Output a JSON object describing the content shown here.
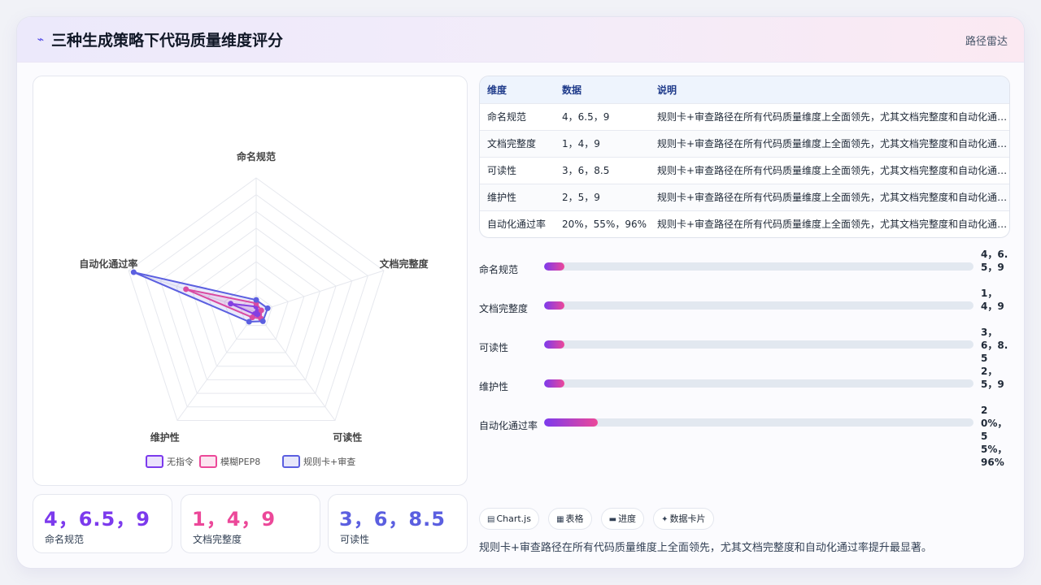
{
  "header": {
    "icon": "pulse-icon",
    "title": "三种生成策略下代码质量维度评分",
    "tag": "路径雷达"
  },
  "chart_data": {
    "type": "radar",
    "title": "",
    "axes": [
      "命名规范",
      "文档完整度",
      "可读性",
      "维护性",
      "自动化通过率"
    ],
    "rlim": [
      0,
      100
    ],
    "grid": true,
    "legend_position": "bottom",
    "series": [
      {
        "name": "无指令",
        "values": [
          4,
          1,
          3,
          2,
          20
        ],
        "color": "#7c3aed"
      },
      {
        "name": "模糊PEP8",
        "values": [
          6.5,
          4,
          6,
          5,
          55
        ],
        "color": "#ec4899"
      },
      {
        "name": "规则卡+审查",
        "values": [
          9,
          9,
          8.5,
          9,
          96
        ],
        "color": "#5b5fe0"
      }
    ]
  },
  "stats": [
    {
      "value": "4，6.5，9",
      "label": "命名规范",
      "color": "#7c3aed"
    },
    {
      "value": "1，4，9",
      "label": "文档完整度",
      "color": "#ec4899"
    },
    {
      "value": "3，6，8.5",
      "label": "可读性",
      "color": "#5b5fe0"
    }
  ],
  "table": {
    "headers": [
      "维度",
      "数据",
      "说明"
    ],
    "rows": [
      [
        "命名规范",
        "4，6.5，9",
        "规则卡+审查路径在所有代码质量维度上全面领先，尤其文档完整度和自动化通过率提升最显著。"
      ],
      [
        "文档完整度",
        "1，4，9",
        "规则卡+审查路径在所有代码质量维度上全面领先，尤其文档完整度和自动化通过率提升最显著。"
      ],
      [
        "可读性",
        "3，6，8.5",
        "规则卡+审查路径在所有代码质量维度上全面领先，尤其文档完整度和自动化通过率提升最显著。"
      ],
      [
        "维护性",
        "2，5，9",
        "规则卡+审查路径在所有代码质量维度上全面领先，尤其文档完整度和自动化通过率提升最显著。"
      ],
      [
        "自动化通过率",
        "20%，55%，96%",
        "规则卡+审查路径在所有代码质量维度上全面领先，尤其文档完整度和自动化通过率提升最显著。"
      ]
    ]
  },
  "progress": [
    {
      "label": "命名规范",
      "value_text": "4，6.5，9",
      "fill": 0.047
    },
    {
      "label": "文档完整度",
      "value_text": "1，4，9",
      "fill": 0.047
    },
    {
      "label": "可读性",
      "value_text": "3，6，8.5",
      "fill": 0.047
    },
    {
      "label": "维护性",
      "value_text": "2，5，9",
      "fill": 0.047
    },
    {
      "label": "自动化通过率",
      "value_text": "20%，55%，96%",
      "fill": 0.125
    }
  ],
  "chips": [
    {
      "icon": "chart-icon",
      "glyph": "▤",
      "label": "Chart.js"
    },
    {
      "icon": "table-icon",
      "glyph": "▦",
      "label": "表格"
    },
    {
      "icon": "progress-icon",
      "glyph": "▬",
      "label": "进度"
    },
    {
      "icon": "card-icon",
      "glyph": "✦",
      "label": "数据卡片"
    }
  ],
  "footnote": "规则卡+审查路径在所有代码质量维度上全面领先，尤其文档完整度和自动化通过率提升最显著。"
}
